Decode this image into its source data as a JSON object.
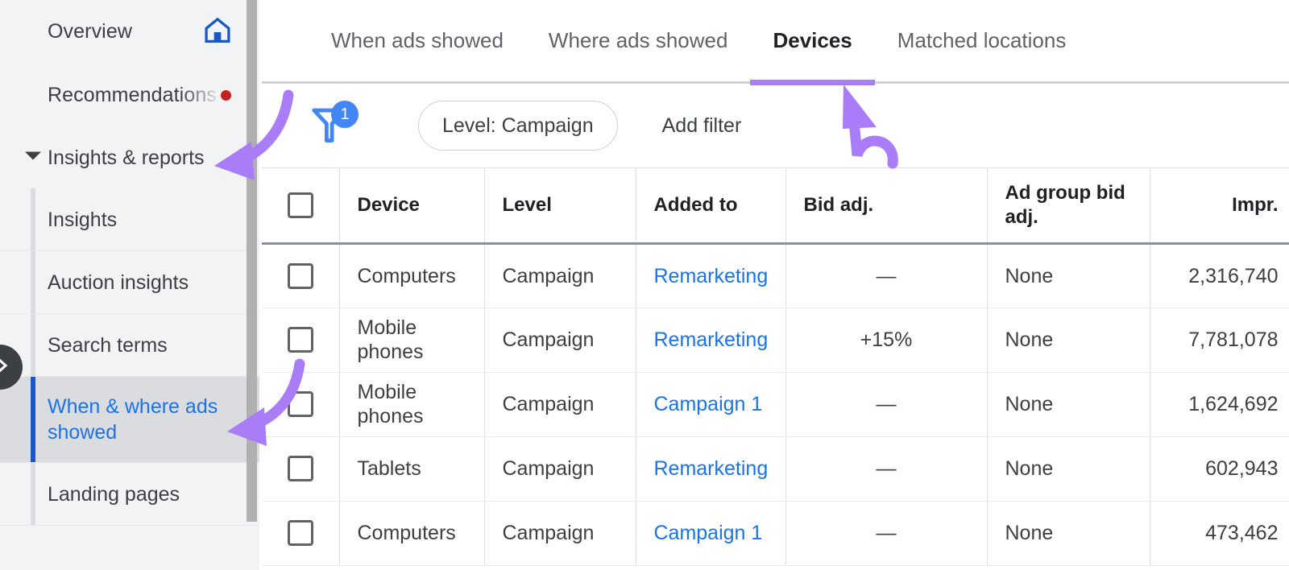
{
  "sidebar": {
    "top_items": [
      {
        "label": "Overview",
        "icon": "home-icon",
        "has_dot": false
      },
      {
        "label": "Recommendations",
        "icon": null,
        "has_dot": true
      }
    ],
    "group": {
      "label": "Insights & reports",
      "expanded": true,
      "caret_icon": "caret-down-icon"
    },
    "sub_items": [
      {
        "label": "Insights",
        "active": false
      },
      {
        "label": "Auction insights",
        "active": false
      },
      {
        "label": "Search terms",
        "active": false
      },
      {
        "label": "When & where ads showed",
        "active": true
      },
      {
        "label": "Landing pages",
        "active": false
      }
    ],
    "collapse_icon": "chevron-right-icon",
    "active_color": "#1a73e8",
    "active_bar_color": "#1a56c4",
    "background": "#f1f3f4"
  },
  "tabs": [
    {
      "label": "When ads showed",
      "active": false
    },
    {
      "label": "Where ads showed",
      "active": false
    },
    {
      "label": "Devices",
      "active": true
    },
    {
      "label": "Matched locations",
      "active": false
    }
  ],
  "tab_underline_color": "#a97cf8",
  "filter_bar": {
    "funnel_icon": "filter-funnel-icon",
    "funnel_badge": "1",
    "funnel_color": "#4285f4",
    "chip_label": "Level: Campaign",
    "add_filter_label": "Add filter"
  },
  "table": {
    "columns": [
      "Device",
      "Level",
      "Added to",
      "Bid adj.",
      "Ad group bid adj.",
      "Impr."
    ],
    "rows": [
      {
        "device": "Computers",
        "level": "Campaign",
        "added_to": "Remarketing",
        "bid_adj": "—",
        "ad_group_bid_adj": "None",
        "impr": "2,316,740"
      },
      {
        "device": "Mobile phones",
        "level": "Campaign",
        "added_to": "Remarketing",
        "bid_adj": "+15%",
        "ad_group_bid_adj": "None",
        "impr": "7,781,078"
      },
      {
        "device": "Mobile phones",
        "level": "Campaign",
        "added_to": "Campaign 1",
        "bid_adj": "—",
        "ad_group_bid_adj": "None",
        "impr": "1,624,692"
      },
      {
        "device": "Tablets",
        "level": "Campaign",
        "added_to": "Remarketing",
        "bid_adj": "—",
        "ad_group_bid_adj": "None",
        "impr": "602,943"
      },
      {
        "device": "Computers",
        "level": "Campaign",
        "added_to": "Campaign 1",
        "bid_adj": "—",
        "ad_group_bid_adj": "None",
        "impr": "473,462"
      }
    ],
    "link_color": "#1a73e8"
  },
  "annotations": {
    "arrow_color": "#a97cf8",
    "arrows": [
      {
        "name": "arrow-to-insights-reports",
        "points_to": "Insights & reports"
      },
      {
        "name": "arrow-to-when-where-ads-showed",
        "points_to": "When & where ads showed"
      },
      {
        "name": "arrow-to-devices-tab",
        "points_to": "Devices"
      }
    ]
  }
}
